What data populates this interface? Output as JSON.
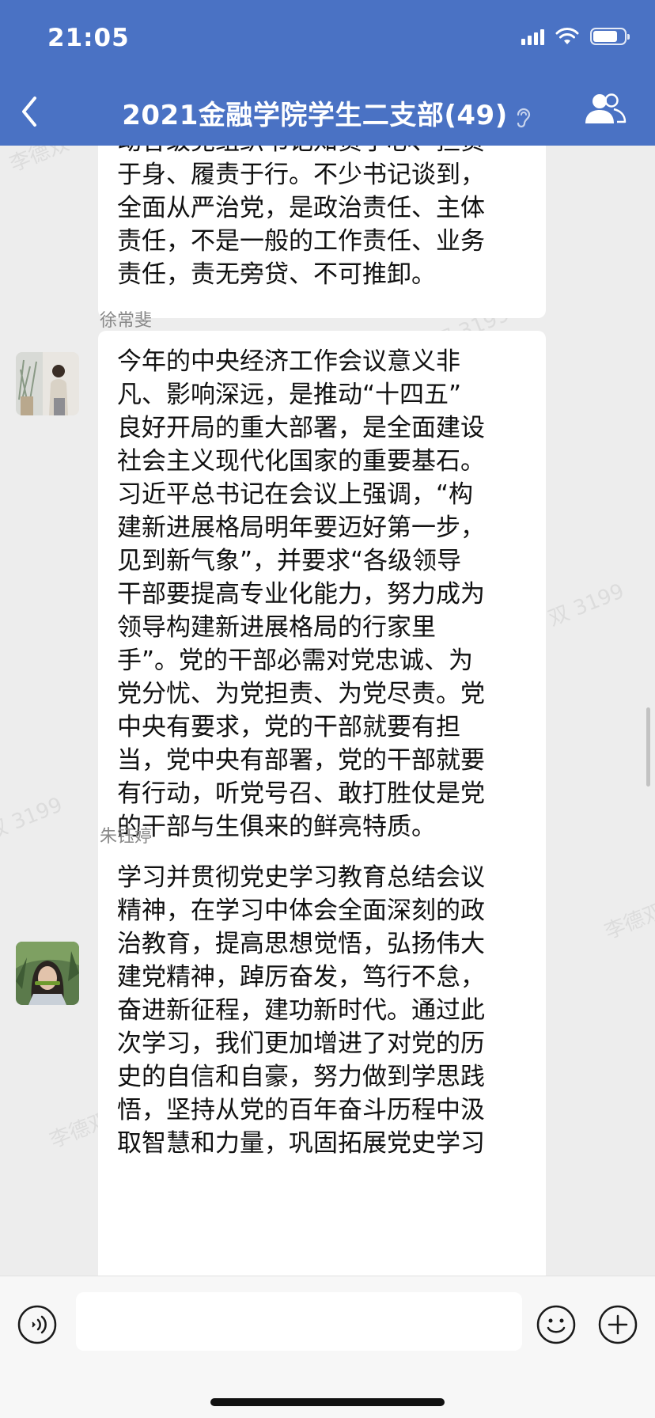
{
  "status_bar": {
    "time": "21:05",
    "battery_level": 0.78
  },
  "header": {
    "title": "2021金融学院学生二支部(49)",
    "back_icon": "chevron-left-icon",
    "muted_icon": "ear-icon",
    "members_icon": "group-members-icon"
  },
  "messages": [
    {
      "sender": "",
      "lines": [
        "动各级党组织书记知责于心、担责",
        "于身、履责于行。不少书记谈到，",
        "全面从严治党，是政治责任、主体",
        "责任，不是一般的工作责任、业务",
        "责任，责无旁贷、不可推卸。"
      ]
    },
    {
      "sender": "徐常斐",
      "lines": [
        "今年的中央经济工作会议意义非",
        "凡、影响深远，是推动“十四五”",
        "良好开局的重大部署，是全面建设",
        "社会主义现代化国家的重要基石。",
        "习近平总书记在会议上强调，“构",
        "建新进展格局明年要迈好第一步，",
        "见到新气象”，并要求“各级领导",
        "干部要提高专业化能力，努力成为",
        "领导构建新进展格局的行家里",
        "手”。党的干部必需对党忠诚、为",
        "党分忧、为党担责、为党尽责。党",
        "中央有要求，党的干部就要有担",
        "当，党中央有部署，党的干部就要",
        "有行动，听党号召、敢打胜仗是党",
        "的干部与生俱来的鲜亮特质。"
      ]
    },
    {
      "sender": "朱钰婷",
      "lines": [
        "学习并贯彻党史学习教育总结会议",
        "精神，在学习中体会全面深刻的政",
        "治教育，提高思想觉悟，弘扬伟大",
        "建党精神，踔厉奋发，笃行不怠，",
        "奋进新征程，建功新时代。通过此",
        "次学习，我们更加增进了对党的历",
        "史的自信和自豪，努力做到学思践",
        "悟，坚持从党的百年奋斗历程中汲",
        "取智慧和力量，巩固拓展党史学习"
      ]
    }
  ],
  "watermarks": [
    "李德双 3199",
    "双 3199",
    "双 3199",
    "李德双",
    "李德双",
    "李德双 3199"
  ],
  "input_bar": {
    "placeholder": "",
    "voice_icon": "voice-icon",
    "emoji_icon": "emoji-icon",
    "plus_icon": "plus-icon"
  }
}
